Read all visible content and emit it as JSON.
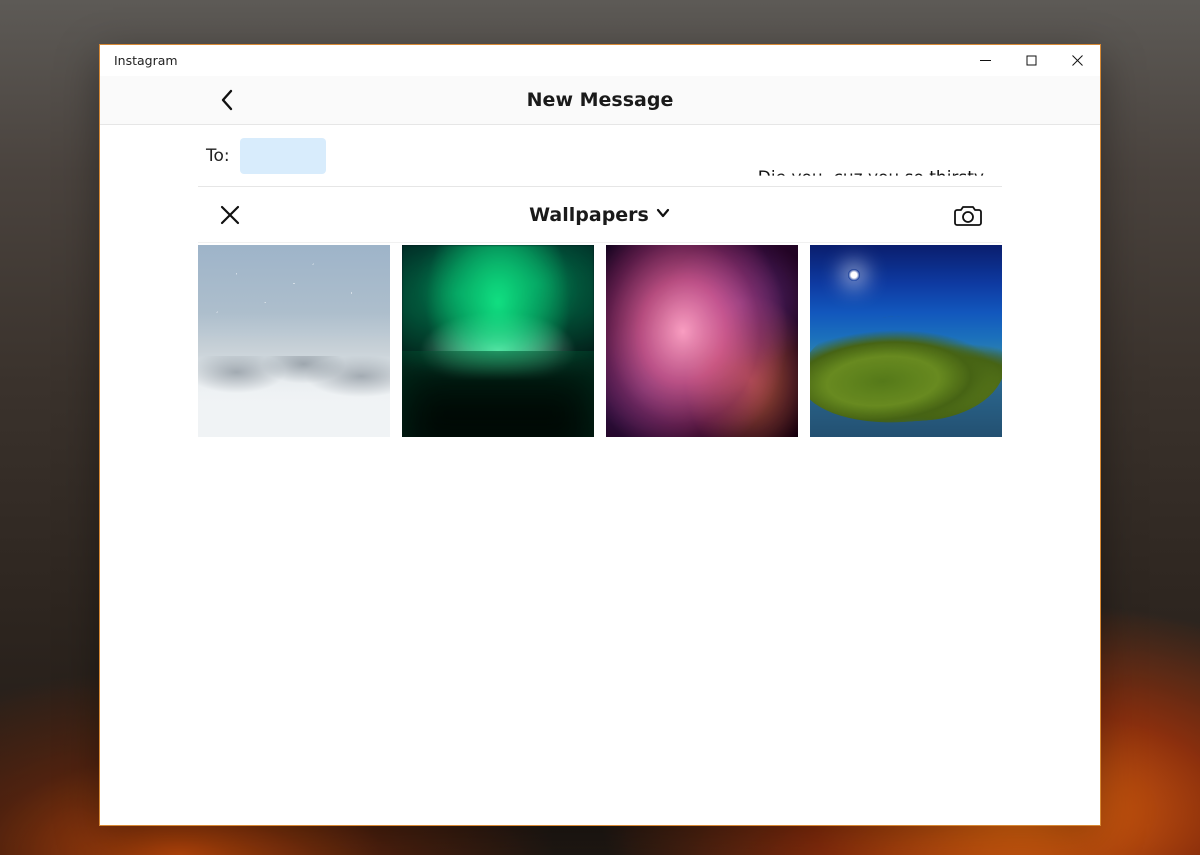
{
  "window": {
    "app_title": "Instagram"
  },
  "header": {
    "title": "New Message"
  },
  "compose": {
    "to_label": "To:",
    "suggestion_text": "Die you, cuz you so thirsty"
  },
  "picker": {
    "album_name": "Wallpapers",
    "thumbnails": [
      {
        "name": "starry-snow-mountains"
      },
      {
        "name": "aurora-borealis"
      },
      {
        "name": "pink-nebula"
      },
      {
        "name": "blue-coast-moss"
      }
    ]
  }
}
